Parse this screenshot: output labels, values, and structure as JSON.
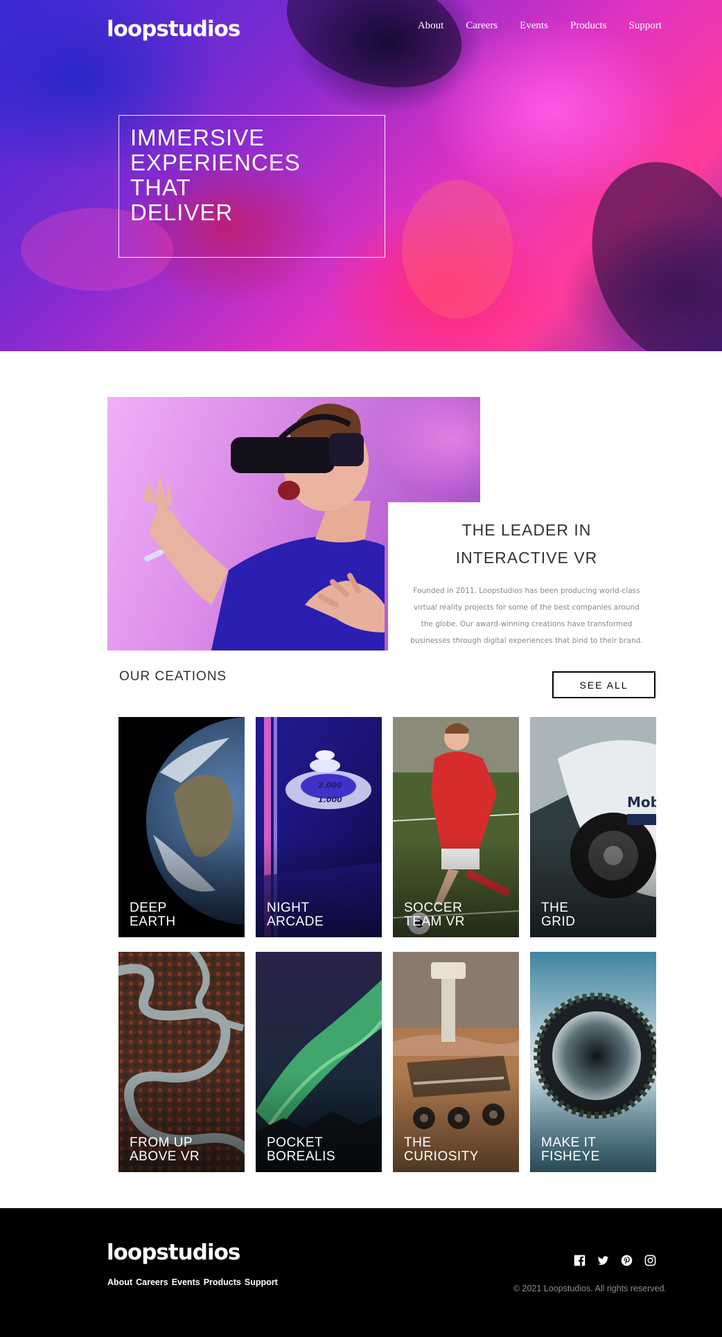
{
  "brand": {
    "logo": "loopstudios"
  },
  "nav": {
    "items": [
      "About",
      "Careers",
      "Events",
      "Products",
      "Support"
    ]
  },
  "hero": {
    "title_lines": [
      "IMMERSIVE",
      "EXPERIENCES",
      "THAT",
      "DELIVER"
    ]
  },
  "intro": {
    "title_lines": [
      "THE LEADER IN",
      "INTERACTIVE VR"
    ],
    "text": "Founded in 2011, Loopstudios has been producing world-class virtual reality projects for some of the best companies around the globe. Our award-winning creations have transformed businesses through digital experiences that bind to their brand."
  },
  "creations": {
    "title": "OUR CEATIONS",
    "see_all_label": "SEE ALL",
    "items": [
      {
        "line1": "DEEP",
        "line2": "EARTH"
      },
      {
        "line1": "NIGHT",
        "line2": "ARCADE"
      },
      {
        "line1": "SOCCER",
        "line2": "TEAM VR"
      },
      {
        "line1": "THE",
        "line2": "GRID"
      },
      {
        "line1": "FROM UP",
        "line2": "ABOVE VR"
      },
      {
        "line1": "POCKET",
        "line2": "BOREALIS"
      },
      {
        "line1": "THE",
        "line2": "CURIOSITY"
      },
      {
        "line1": "MAKE IT",
        "line2": "FISHEYE"
      }
    ]
  },
  "footer": {
    "logo": "loopstudios",
    "nav": [
      "About",
      "Careers",
      "Events",
      "Products",
      "Support"
    ],
    "social_icons": [
      "facebook-icon",
      "twitter-icon",
      "pinterest-icon",
      "instagram-icon"
    ],
    "copyright": "© 2021 Loopstudios. All rights reserved."
  }
}
